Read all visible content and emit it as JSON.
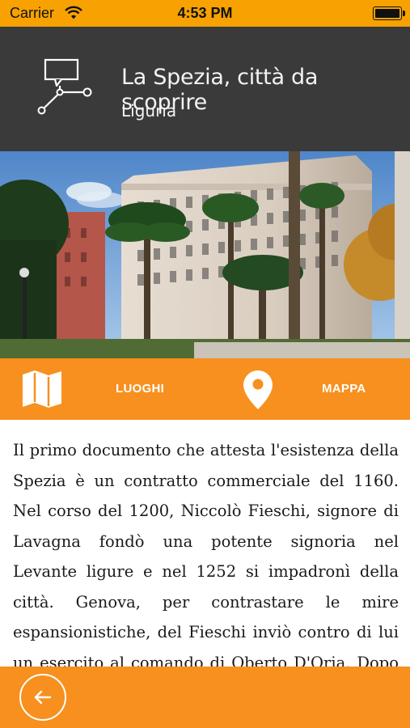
{
  "status_bar": {
    "carrier": "Carrier",
    "time": "4:53 PM",
    "battery_level": 1.0
  },
  "header": {
    "icon": "route-icon",
    "title": "La Spezia, città da scoprire",
    "subtitle": "Liguria"
  },
  "actions": {
    "luoghi_label": "LUOGHI",
    "luoghi_icon": "map-icon",
    "mappa_label": "MAPPA",
    "mappa_icon": "location-pin-icon"
  },
  "article": {
    "text": "Il primo documento che attesta l'esistenza della Spezia è un contratto commerciale del 1160. Nel corso del 1200, Niccolò Fieschi, signore di Lavagna fondò una potente signoria nel Levante ligure e nel 1252 si impadronì della città. Genova, per contrastare le mire espansionistiche, del Fieschi inviò contro di lui un esercito al comando di Oberto D'Oria. Dopo feroci battaglie, i Fieschi"
  },
  "footer": {
    "back_icon": "arrow-left-icon"
  },
  "colors": {
    "status_bar": "#f7a200",
    "header_bg": "#3a3a3a",
    "accent": "#f7901e",
    "text": "#1a1a1a"
  }
}
